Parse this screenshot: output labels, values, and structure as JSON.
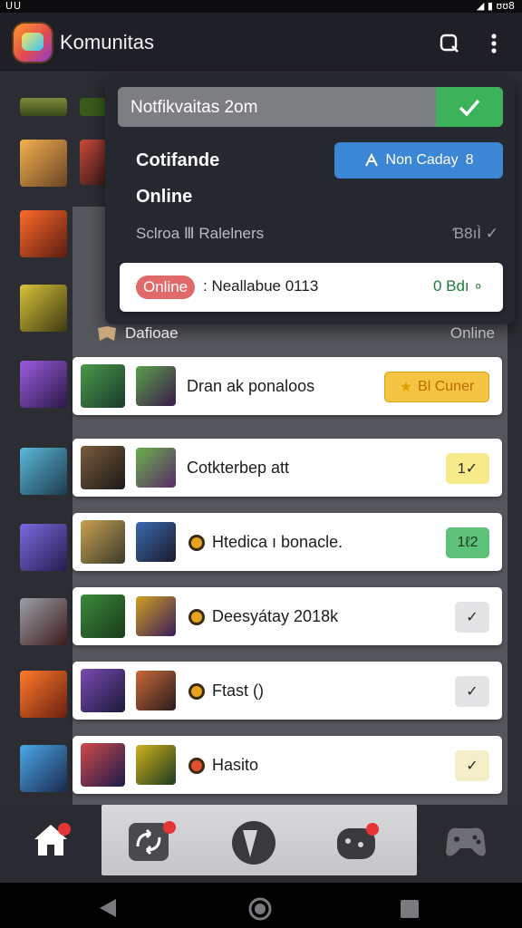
{
  "status": {
    "left": "ᑌᑌ",
    "right": "◢ ▮ ʊʊ8"
  },
  "appbar": {
    "title": "Komunitas",
    "search_icon": "search-icon",
    "menu_icon": "more-vert-icon"
  },
  "popup": {
    "notification_text": "Notfikvaitas 2om",
    "heading_1": "Cotifande",
    "heading_2": "Online",
    "blue_button_label": "Non Caday",
    "blue_button_suffix": "8",
    "sub_left": "Sclroa Ⅲ Ralelners",
    "sub_right": "Ɓ8ıÌ ✓"
  },
  "online_card": {
    "pill": "Online",
    "text": ": Neallabue 0113",
    "right": "0 Bdı ∘"
  },
  "section": {
    "title": "Dafioae",
    "right": "Online"
  },
  "rows": [
    {
      "label": "Dran ak ponaloos",
      "badge": "Bl Cuner",
      "badge_type": "gold"
    },
    {
      "label": "Cotkterbep att",
      "badge": "1✓",
      "badge_type": "yellow"
    },
    {
      "label": "Htedica ı bonacle.",
      "badge": "1ℓ2",
      "badge_type": "green"
    },
    {
      "label": "Deesyátay 2018k",
      "badge": "✓",
      "badge_type": "grey"
    },
    {
      "label": "Ftast ()",
      "badge": "✓",
      "badge_type": "grey"
    },
    {
      "label": "Hasito",
      "badge": "✓",
      "badge_type": "cream"
    }
  ],
  "colors": {
    "accent_blue": "#3c86d6",
    "accent_green": "#3cb35a",
    "badge_red": "#e53535"
  }
}
